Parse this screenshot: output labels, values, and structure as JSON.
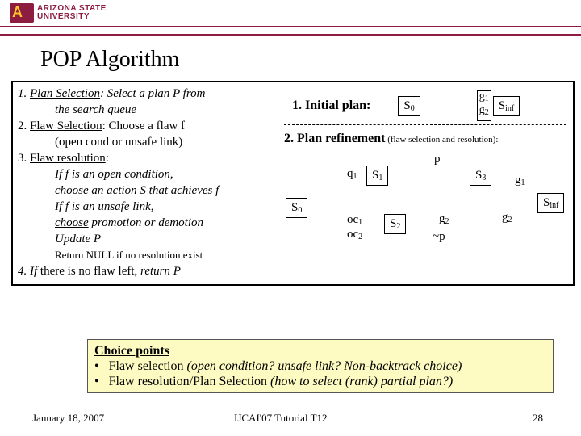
{
  "header": {
    "uni_l1": "ARIZONA STATE",
    "uni_l2": "UNIVERSITY"
  },
  "title": "POP Algorithm",
  "algo": {
    "l1a": "1.  ",
    "l1u": "Plan Selection",
    "l1b": ": Select a plan P from",
    "l2": "the search queue",
    "l3a": "2. ",
    "l3u": "Flaw Selection",
    "l3b": ": Choose a flaw f",
    "l4": "(open cond or unsafe link)",
    "l5a": "3. ",
    "l5u": "Flaw resolution",
    "l5b": ":",
    "l6": "If  f is an open condition,",
    "l7a": "choose",
    "l7b": " an action S that achieves f",
    "l8": "If f is an unsafe link,",
    "l9a": "choose",
    "l9b": "  promotion or demotion",
    "l10": "Update P",
    "l11": "Return NULL if no resolution exist",
    "l12a": "4. If ",
    "l12b": "there is no flaw left, ",
    "l12c": "return P"
  },
  "right": {
    "initial": "1. Initial plan:",
    "refine_b": "2. Plan refinement",
    "refine_s": " (flaw selection and resolution):"
  },
  "nodes": {
    "s0": "S",
    "s0s": "0",
    "s1": "S",
    "s1s": "1",
    "s2": "S",
    "s2s": "2",
    "s3": "S",
    "s3s": "3",
    "sinf": "S",
    "sinfs": "inf"
  },
  "lbls": {
    "g1": "g",
    "g1s": "1",
    "g2": "g",
    "g2s": "2",
    "q1": "q",
    "q1s": "1",
    "p": "p",
    "np": "~p",
    "oc1": "oc",
    "oc1s": "1",
    "oc2": "oc",
    "oc2s": "2"
  },
  "choice": {
    "h": "Choice points",
    "b1a": "Flaw selection ",
    "b1b": "(open condition? unsafe link? Non-backtrack choice)",
    "b2a": "Flaw resolution/Plan Selection ",
    "b2b": "(how to select (rank) partial plan?)"
  },
  "footer": {
    "date": "January 18, 2007",
    "venue": "IJCAI'07 Tutorial T12",
    "page": "28"
  }
}
